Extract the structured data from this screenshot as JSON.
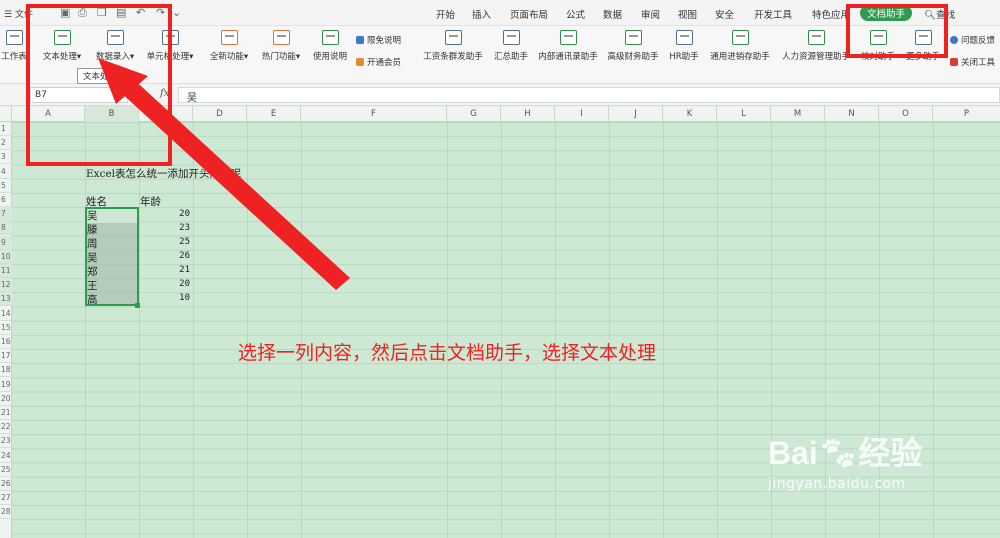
{
  "menubar": {
    "file_label": "文件",
    "tabs": [
      "开始",
      "插入",
      "页面布局",
      "公式",
      "数据",
      "审阅",
      "视图",
      "安全",
      "开发工具",
      "特色应用",
      "文档助手"
    ],
    "active_tab": "文档助手",
    "search_label": "查找"
  },
  "ribbon": {
    "buttons": [
      "工作表",
      "文本处理",
      "数据录入",
      "单元格处理",
      "全新功能",
      "热门功能",
      "使用说明"
    ],
    "side_links": [
      "限免说明",
      "开通会员"
    ],
    "assistants": [
      "工资条群发助手",
      "汇总助手",
      "内部通讯录助手",
      "高级财务助手",
      "HR助手",
      "通用进销存助手",
      "人力资源管理助手",
      "校对助手",
      "更多助手"
    ],
    "right_links": [
      "问题反馈",
      "关闭工具"
    ],
    "tooltip": "文本处理"
  },
  "formula_bar": {
    "cell_ref": "B7",
    "fx_label": "fx",
    "value": "吴"
  },
  "grid": {
    "columns": [
      "A",
      "B",
      "C",
      "D",
      "E",
      "F",
      "G",
      "H",
      "I",
      "J",
      "K",
      "L",
      "M",
      "N",
      "O",
      "P"
    ],
    "rows": [
      "1",
      "2",
      "3",
      "4",
      "5",
      "6",
      "7",
      "8",
      "9",
      "10",
      "11",
      "12",
      "13",
      "14",
      "15",
      "16",
      "17",
      "18",
      "19",
      "20",
      "21",
      "22",
      "23",
      "24",
      "25",
      "26",
      "27",
      "28"
    ]
  },
  "sheet": {
    "heading": "Excel表怎么统一添加开头内容呢",
    "col_name_header": "姓名",
    "col_age_header": "年龄",
    "names": [
      "吴",
      "滕",
      "周",
      "吴",
      "郑",
      "王",
      "高"
    ],
    "ages": [
      "20",
      "23",
      "25",
      "26",
      "21",
      "20",
      "10"
    ]
  },
  "annotation": {
    "text": "选择一列内容，然后点击文档助手，选择文本处理"
  },
  "watermark": {
    "brand": "Bai",
    "brand_cn": "经验",
    "url": "jingyan.baidu.com"
  },
  "colors": {
    "accent": "#2e9c4f",
    "annotation_red": "#ee2222",
    "sheet_bg": "#cde8d3"
  }
}
